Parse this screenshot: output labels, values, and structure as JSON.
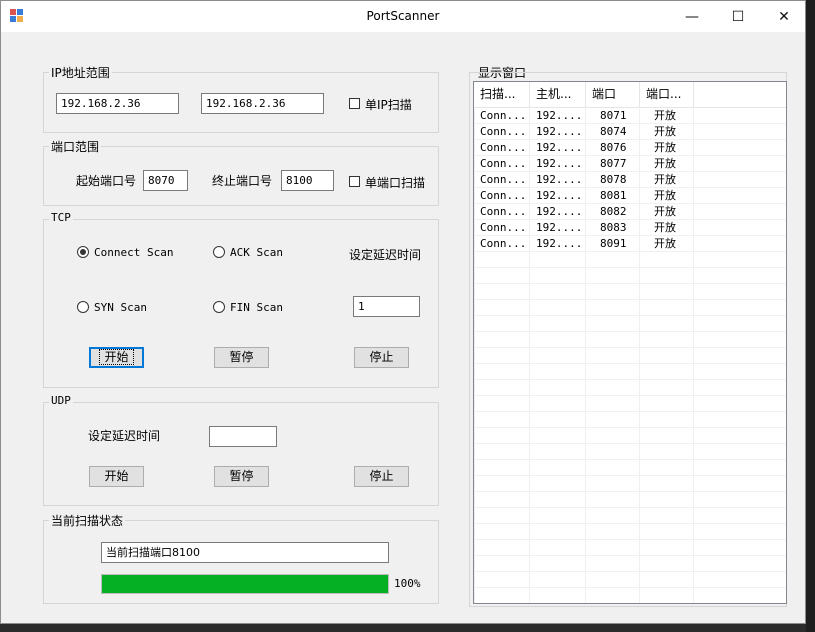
{
  "window": {
    "title": "PortScanner"
  },
  "ip_range": {
    "legend": "IP地址范围",
    "start_ip": "192.168.2.36",
    "end_ip": "192.168.2.36",
    "single_ip_label": "单IP扫描",
    "single_ip_checked": false
  },
  "port_range": {
    "legend": "端口范围",
    "start_label": "起始端口号",
    "start_value": "8070",
    "end_label": "终止端口号",
    "end_value": "8100",
    "single_port_label": "单端口扫描",
    "single_port_checked": false
  },
  "tcp": {
    "legend": "TCP",
    "options": [
      {
        "label": "Connect Scan",
        "selected": true
      },
      {
        "label": "ACK Scan",
        "selected": false
      },
      {
        "label": "SYN Scan",
        "selected": false
      },
      {
        "label": "FIN Scan",
        "selected": false
      }
    ],
    "delay_label": "设定延迟时间",
    "delay_value": "1",
    "start_label": "开始",
    "pause_label": "暂停",
    "stop_label": "停止"
  },
  "udp": {
    "legend": "UDP",
    "delay_label": "设定延迟时间",
    "delay_value": "",
    "start_label": "开始",
    "pause_label": "暂停",
    "stop_label": "停止"
  },
  "status": {
    "legend": "当前扫描状态",
    "text": "当前扫描端口8100",
    "progress_percent": 100,
    "progress_label": "100%",
    "progress_color": "#06b025"
  },
  "display": {
    "legend": "显示窗口",
    "columns": [
      "扫描...",
      "主机...",
      "端口",
      "端口..."
    ],
    "rows": [
      [
        "Conn...",
        "192....",
        "8071",
        "开放"
      ],
      [
        "Conn...",
        "192....",
        "8074",
        "开放"
      ],
      [
        "Conn...",
        "192....",
        "8076",
        "开放"
      ],
      [
        "Conn...",
        "192....",
        "8077",
        "开放"
      ],
      [
        "Conn...",
        "192....",
        "8078",
        "开放"
      ],
      [
        "Conn...",
        "192....",
        "8081",
        "开放"
      ],
      [
        "Conn...",
        "192....",
        "8082",
        "开放"
      ],
      [
        "Conn...",
        "192....",
        "8083",
        "开放"
      ],
      [
        "Conn...",
        "192....",
        "8091",
        "开放"
      ]
    ]
  },
  "icons": {
    "app": "app-window-icon",
    "minimize": "minimize-icon",
    "maximize": "maximize-icon",
    "close": "close-icon"
  },
  "glyphs": {
    "minimize": "—",
    "maximize": "☐",
    "close": "✕"
  }
}
